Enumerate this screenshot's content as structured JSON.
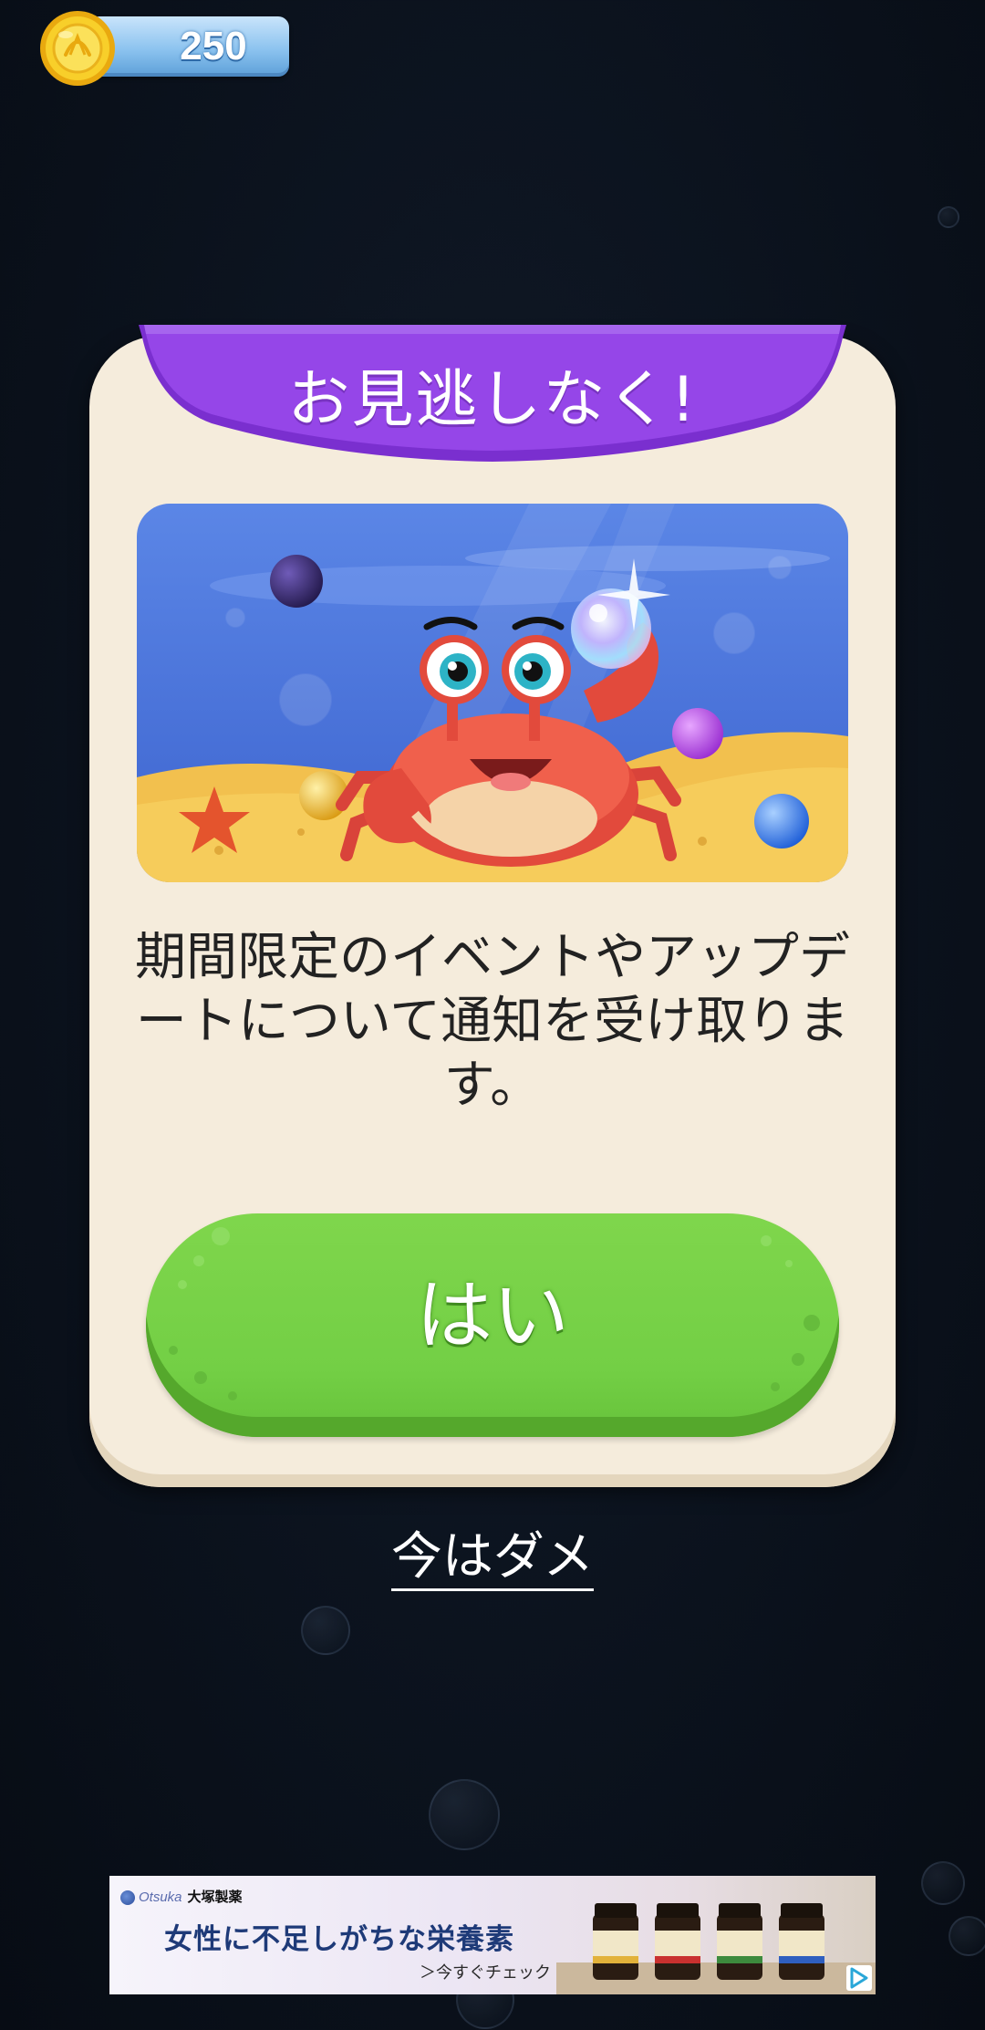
{
  "currency": {
    "coins": "250",
    "icon": "gold-coin-icon"
  },
  "dialog": {
    "title": "お見逃しなく!",
    "message": "期間限定のイベントやアップデートについて通知を受け取ります。",
    "confirm_label": "はい",
    "dismiss_label": "今はダメ",
    "illustration": "crab-with-bubbles-illustration"
  },
  "ad": {
    "brand_en": "Otsuka",
    "brand_jp": "大塚製薬",
    "headline": "女性に不足しがちな栄養素",
    "cta": "＞今すぐチェック",
    "choice_icon": "adchoices-icon"
  },
  "colors": {
    "background": "#0b121d",
    "dialog": "#f5ecdc",
    "banner": "#8a3fe0",
    "confirm_button": "#73cf45",
    "coin_pill": "#8cc3ef"
  }
}
